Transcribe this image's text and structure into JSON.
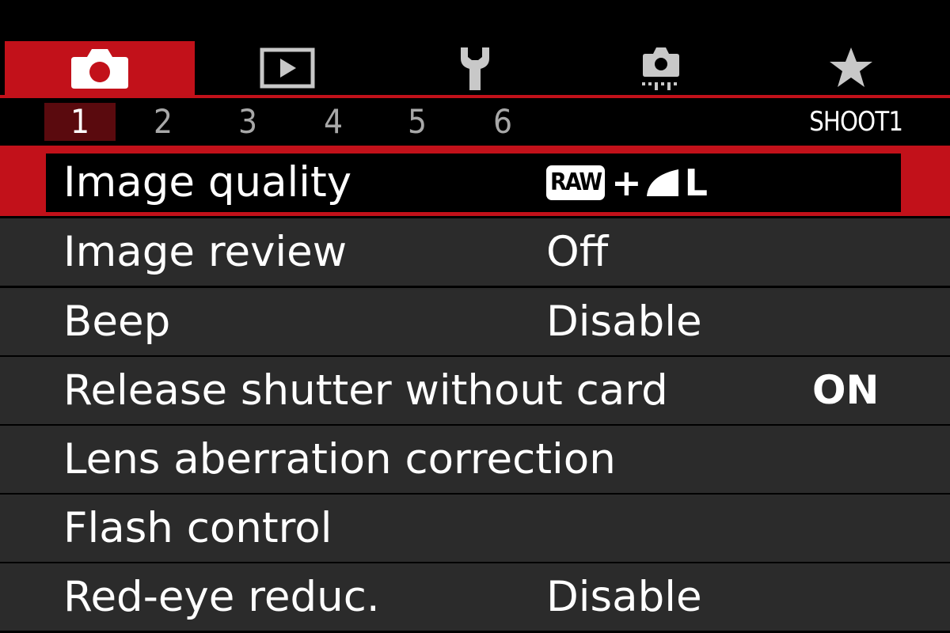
{
  "tabs": [
    {
      "name": "shooting-tab",
      "icon": "camera-icon",
      "active": true
    },
    {
      "name": "playback-tab",
      "icon": "play-icon",
      "active": false
    },
    {
      "name": "setup-tab",
      "icon": "wrench-icon",
      "active": false
    },
    {
      "name": "custom-tab",
      "icon": "camera-settings-icon",
      "active": false
    },
    {
      "name": "my-menu-tab",
      "icon": "star-icon",
      "active": false
    }
  ],
  "pages": {
    "numbers": [
      "1",
      "2",
      "3",
      "4",
      "5",
      "6"
    ],
    "active_index": 0,
    "title": "SHOOT1"
  },
  "menu": {
    "selected_index": 0,
    "items": [
      {
        "label": "Image quality",
        "value_raw": "RAW",
        "value_plus": "+",
        "value_size": "L",
        "value_icon": "jpeg-fine-quality-icon"
      },
      {
        "label": "Image review",
        "value": "Off"
      },
      {
        "label": "Beep",
        "value": "Disable"
      },
      {
        "label": "Release shutter without card",
        "value": "ON"
      },
      {
        "label": "Lens aberration correction",
        "value": ""
      },
      {
        "label": "Flash control",
        "value": ""
      },
      {
        "label": "Red-eye reduc.",
        "value": "Disable"
      }
    ]
  },
  "colors": {
    "accent": "#c2111a",
    "row_background": "#2b2b2b",
    "active_page_background": "#5a0a0e",
    "inactive_page_text": "#a8a8a8"
  }
}
